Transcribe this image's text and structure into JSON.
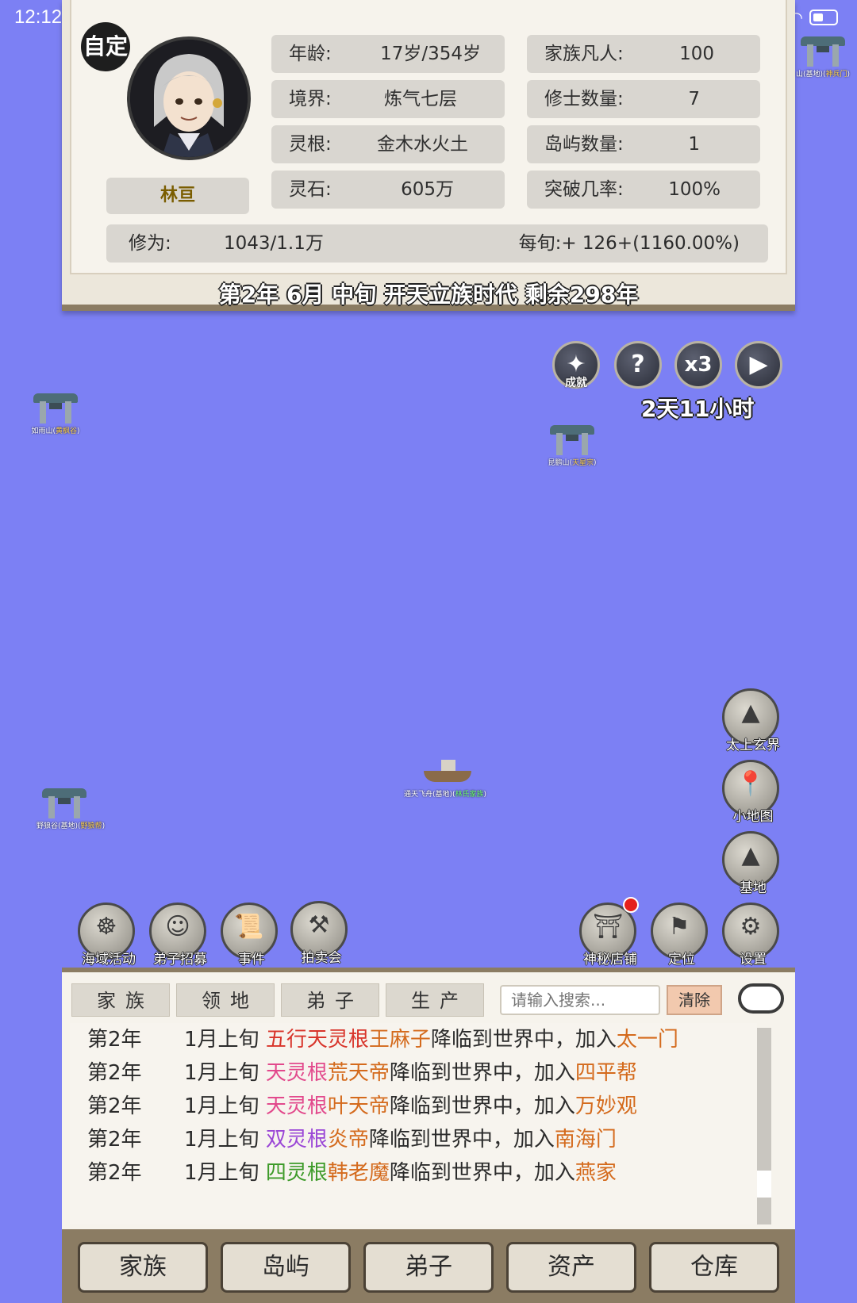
{
  "status_bar": {
    "time": "12:12"
  },
  "character": {
    "badge": "自定",
    "name": "林亘",
    "stats_left": [
      {
        "label": "年龄:",
        "value": "17岁/354岁"
      },
      {
        "label": "境界:",
        "value": "炼气七层"
      },
      {
        "label": "灵根:",
        "value": "金木水火土"
      },
      {
        "label": "灵石:",
        "value": "605万"
      }
    ],
    "stats_right": [
      {
        "label": "家族凡人:",
        "value": "100"
      },
      {
        "label": "修士数量:",
        "value": "7"
      },
      {
        "label": "岛屿数量:",
        "value": "1"
      },
      {
        "label": "突破几率:",
        "value": "100%"
      }
    ],
    "cultivation_label": "修为:",
    "cultivation_value": "1043/1.1万",
    "per_period": "每旬:+ 126+(1160.00%)"
  },
  "era_text": "第2年 6月 中旬  开天立族时代 剩余298年",
  "controls": {
    "achievement_label": "成就",
    "help": "?",
    "speed": "x3",
    "timer": "2天11小时"
  },
  "map_markers": [
    {
      "name": "如雨山",
      "faction": "黄枫谷"
    },
    {
      "name": "昆鹏山",
      "faction": "天星宗"
    },
    {
      "name": "野狼谷(基地)",
      "faction": "野狼帮"
    },
    {
      "name": "通天飞舟(基地)",
      "faction": "林氏家族"
    },
    {
      "name": "山(基地)",
      "faction": "神兵门"
    }
  ],
  "side_buttons": [
    "太上玄界",
    "小地图",
    "基地"
  ],
  "left_action_buttons": [
    "海域活动",
    "弟子招募",
    "事件",
    "拍卖会"
  ],
  "right_action_buttons": [
    "神秘店铺",
    "定位",
    "设置"
  ],
  "log": {
    "tabs": [
      "家族",
      "领地",
      "弟子",
      "生产"
    ],
    "search_placeholder": "请输入搜索...",
    "clear_label": "清除",
    "entries": [
      {
        "year": "第2年",
        "time": "1月上旬",
        "root": "五行天灵根",
        "person": "王麻子",
        "mid": "降临到世界中，加入",
        "faction": "太一门"
      },
      {
        "year": "第2年",
        "time": "1月上旬",
        "root": "天灵根",
        "person": "荒天帝",
        "mid": "降临到世界中，加入",
        "faction": "四平帮"
      },
      {
        "year": "第2年",
        "time": "1月上旬",
        "root": "天灵根",
        "person": "叶天帝",
        "mid": "降临到世界中，加入",
        "faction": "万妙观"
      },
      {
        "year": "第2年",
        "time": "1月上旬",
        "root": "双灵根",
        "person": "炎帝",
        "mid": "降临到世界中，加入",
        "faction": "南海门"
      },
      {
        "year": "第2年",
        "time": "1月上旬",
        "root": "四灵根",
        "person": "韩老魔",
        "mid": "降临到世界中，加入",
        "faction": "燕家"
      }
    ]
  },
  "bottom_nav": [
    "家族",
    "岛屿",
    "弟子",
    "资产",
    "仓库"
  ],
  "colors": {
    "background": "#7c80f4",
    "panel": "#f6f3ec",
    "root_five": "#d8342a",
    "root_heaven": "#e2498c",
    "root_dual": "#9a46d6",
    "root_four": "#3c9a28",
    "name_orange": "#d46a1c"
  }
}
